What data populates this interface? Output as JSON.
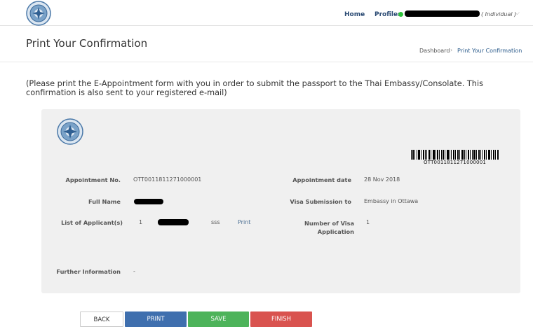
{
  "header": {
    "home_label": "Home",
    "profiles_label": "Profiles",
    "user_type": "( Individual )",
    "chevron": "⌵",
    "status_color": "#2ec23a"
  },
  "page": {
    "title": "Print Your Confirmation",
    "breadcrumb": {
      "dashboard": "Dashboard",
      "separator": "›",
      "current": "Print Your Confirmation"
    },
    "notice": "(Please print the E-Appointment form with you in order to submit the passport to the Thai Embassy/Consolate. This confirmation is also sent to your registered e-mail)"
  },
  "confirmation": {
    "barcode_text": "OTT0011811271000001",
    "appointment_no_label": "Appointment No.",
    "appointment_no": "OTT0011811271000001",
    "appointment_date_label": "Appointment date",
    "appointment_date": "28 Nov 2018",
    "full_name_label": "Full Name",
    "visa_submission_label": "Visa Submission to",
    "visa_submission": "Embassy in Ottawa",
    "applicants_label": "List of Applicant(s)",
    "applicant_index": "1",
    "applicant_extra": "sss",
    "applicant_print": "Print",
    "num_visa_label": "Number of Visa Application",
    "num_visa": "1",
    "further_info_label": "Further Information",
    "further_info": "-"
  },
  "buttons": {
    "back": "BACK",
    "print": "PRINT",
    "save": "SAVE",
    "finish": "FINISH"
  }
}
